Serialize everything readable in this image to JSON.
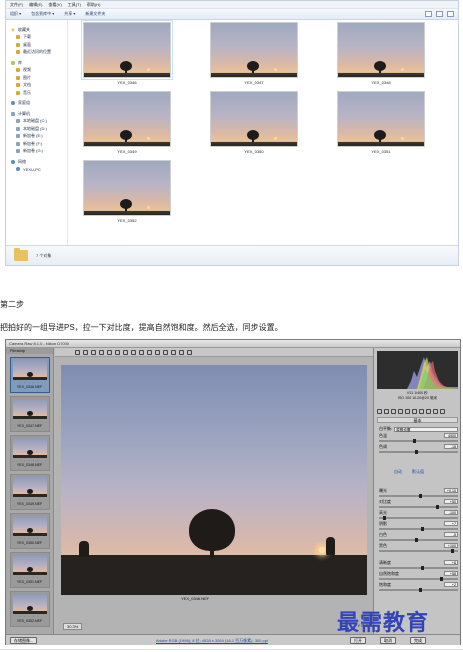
{
  "explorer": {
    "menu": [
      "文件(F)",
      "编辑(E)",
      "查看(V)",
      "工具(T)",
      "帮助(H)"
    ],
    "toolbar": [
      "组织 ▾",
      "包含到库中 ▾",
      "共享 ▾",
      "新建文件夹"
    ],
    "nav": [
      {
        "label": "收藏夹",
        "type": "group",
        "icon": "star-icon"
      },
      {
        "label": "下载",
        "type": "item",
        "icon": "folder-icon"
      },
      {
        "label": "桌面",
        "type": "item",
        "icon": "folder-icon"
      },
      {
        "label": "最近访问的位置",
        "type": "item",
        "icon": "folder-icon"
      },
      {
        "label": "库",
        "type": "group",
        "icon": "library-icon"
      },
      {
        "label": "视频",
        "type": "item",
        "icon": "folder-icon"
      },
      {
        "label": "图片",
        "type": "item",
        "icon": "folder-icon"
      },
      {
        "label": "文档",
        "type": "item",
        "icon": "folder-icon"
      },
      {
        "label": "音乐",
        "type": "item",
        "icon": "folder-icon"
      },
      {
        "label": "家庭组",
        "type": "group",
        "icon": "network-icon"
      },
      {
        "label": "计算机",
        "type": "group",
        "icon": "drive-icon"
      },
      {
        "label": "本地磁盘 (C:)",
        "type": "item",
        "icon": "drive-icon"
      },
      {
        "label": "本地磁盘 (D:)",
        "type": "item",
        "icon": "drive-icon"
      },
      {
        "label": "新加卷 (E:)",
        "type": "item",
        "icon": "drive-icon"
      },
      {
        "label": "新加卷 (F:)",
        "type": "item",
        "icon": "drive-icon"
      },
      {
        "label": "新加卷 (G:)",
        "type": "item",
        "icon": "drive-icon"
      },
      {
        "label": "网络",
        "type": "group",
        "icon": "network-icon"
      },
      {
        "label": "YEXU-PC",
        "type": "item",
        "icon": "network-icon"
      }
    ],
    "files": [
      "YEX_0346",
      "YEX_0347",
      "YEX_0348",
      "YEX_0349",
      "YEX_0350",
      "YEX_0351",
      "YEX_0352"
    ],
    "status": "7 个对象"
  },
  "article": {
    "step_title": "第二步",
    "step_desc": "把拍好的一组导进PS，拉一下对比度，提高自然饱和度。然后全选，同步设置。"
  },
  "raw": {
    "title": "Camera Raw 8.1.0 - Nikon D7000",
    "filmstrip_label": "Filmstrip",
    "filmstrip_files": [
      "YEX_0346.NEF",
      "YEX_0347.NEF",
      "YEX_0348.NEF",
      "YEX_0349.NEF",
      "YEX_0350.NEF",
      "YEX_0351.NEF",
      "YEX_0352.NEF"
    ],
    "rating_dots": "· · · · ·",
    "photo_name": "YEX_0346.NEF",
    "zoom": "30.3%",
    "preview_controls": "Y  ⊡  ⊞",
    "exif": [
      "f/11   1/400 秒",
      "ISO 100   10-20@20 毫米"
    ],
    "panel_head": "基本",
    "wb_label": "白平衡:",
    "wb_value": "原照设置",
    "sliders": [
      {
        "label": "色温",
        "value": "4900",
        "pos": 0.45
      },
      {
        "label": "色调",
        "value": "-18",
        "pos": 0.48
      },
      {
        "label": "曝光",
        "value": "+0.10",
        "pos": 0.52
      },
      {
        "label": "对比度",
        "value": "+50",
        "pos": 0.75
      },
      {
        "label": "高光",
        "value": "-100",
        "pos": 0.05
      },
      {
        "label": "阴影",
        "value": "+7",
        "pos": 0.55
      },
      {
        "label": "白色",
        "value": "-5",
        "pos": 0.48
      },
      {
        "label": "黑色",
        "value": "+100",
        "pos": 0.95
      },
      {
        "label": "清晰度",
        "value": "+8",
        "pos": 0.55
      },
      {
        "label": "自然饱和度",
        "value": "+58",
        "pos": 0.8
      },
      {
        "label": "饱和度",
        "value": "+2",
        "pos": 0.52
      }
    ],
    "auto_links": [
      "自动",
      "默认值"
    ],
    "workflow": "Adobe RGB (1998); 8 位; 4928 x 3264 (16.1 百万像素); 300 ppi",
    "btn_save": "存储图像...",
    "btn_open": "打开",
    "btn_cancel": "取消",
    "btn_done": "完成"
  },
  "watermark": "最需教育"
}
